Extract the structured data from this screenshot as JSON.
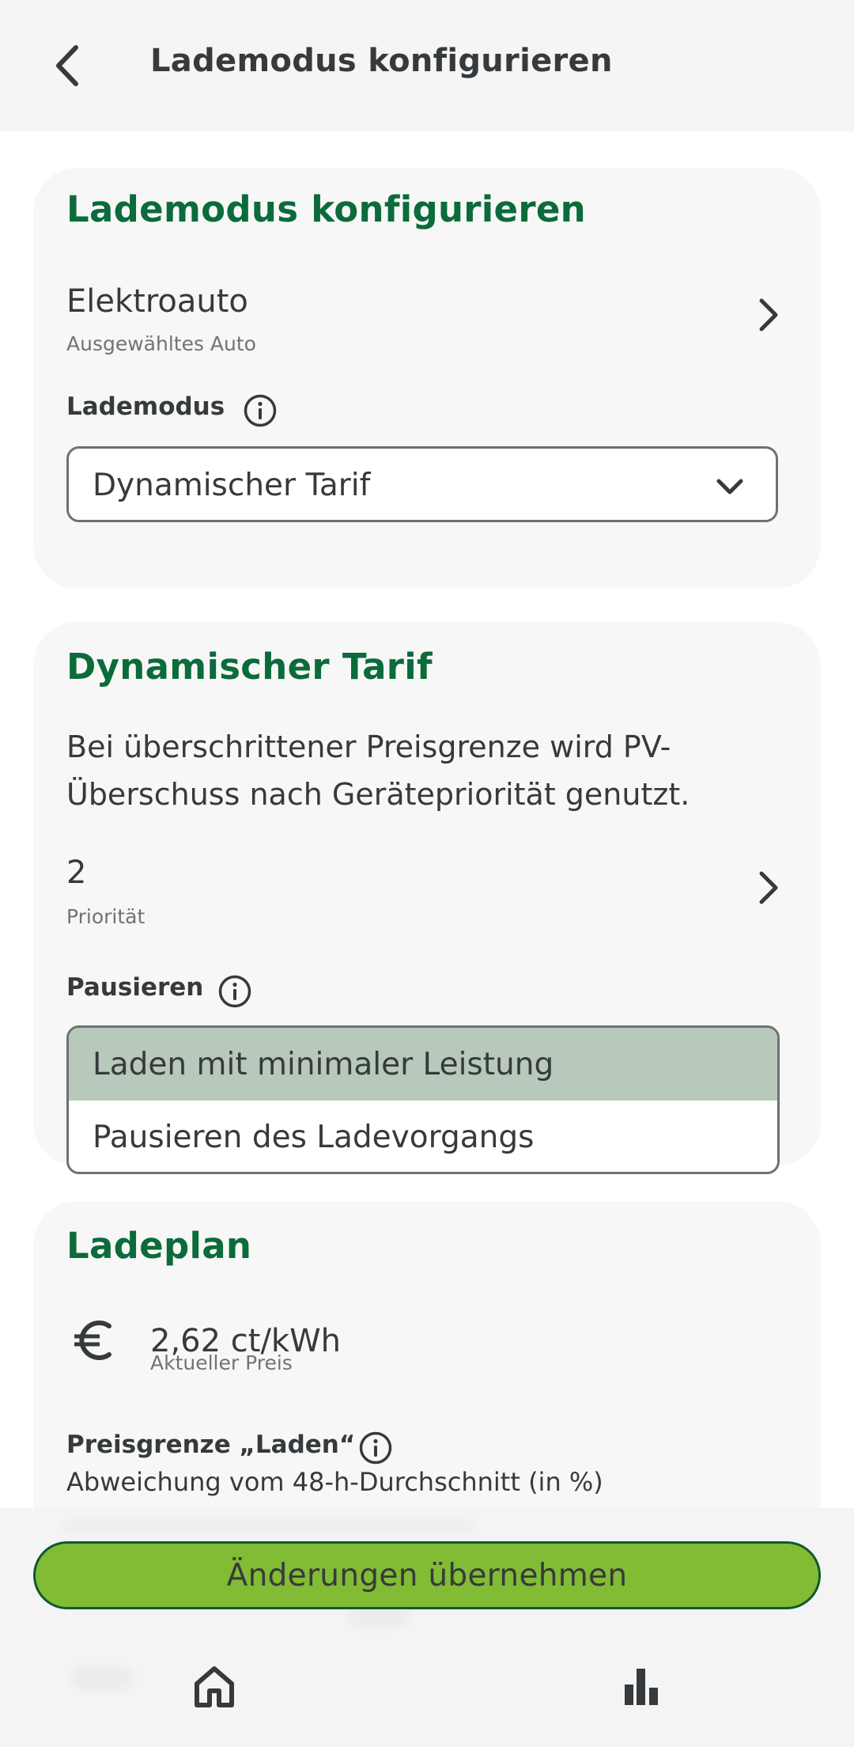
{
  "header": {
    "title": "Lademodus konfigurieren",
    "back_icon": "chevron-left-icon"
  },
  "card_config": {
    "title": "Lademodus konfigurieren",
    "vehicle": {
      "value": "Elektroauto",
      "caption": "Ausgewähltes Auto"
    },
    "mode_label": "Lademodus",
    "mode_value": "Dynamischer Tarif"
  },
  "card_tariff": {
    "title": "Dynamischer Tarif",
    "description": "Bei überschrittener Preisgrenze wird PV-Überschuss nach Gerätepriorität genutzt.",
    "priority": {
      "value": "2",
      "caption": "Priorität"
    },
    "pause_label": "Pausieren",
    "pause_options": [
      "Laden mit minimaler Leistung",
      "Pausieren des Ladevorgangs"
    ],
    "pause_selected": "Laden mit minimaler Leistung"
  },
  "card_plan": {
    "title": "Ladeplan",
    "currency_icon": "euro-icon",
    "price": {
      "value": "2,62 ct/kWh",
      "caption": "Aktueller Preis"
    },
    "limit_label": "Preisgrenze „Laden“",
    "limit_description": "Abweichung vom 48-h-Durchschnitt (in %)"
  },
  "actions": {
    "apply_label": "Änderungen übernehmen"
  },
  "bottom_nav": {
    "items": [
      "home-icon",
      "bar-chart-icon"
    ]
  },
  "colors": {
    "accent_green": "#0b6b3a",
    "button_green": "#82bb34",
    "selected_option": "#b8c8ba",
    "card_bg": "#f7f7f7"
  }
}
